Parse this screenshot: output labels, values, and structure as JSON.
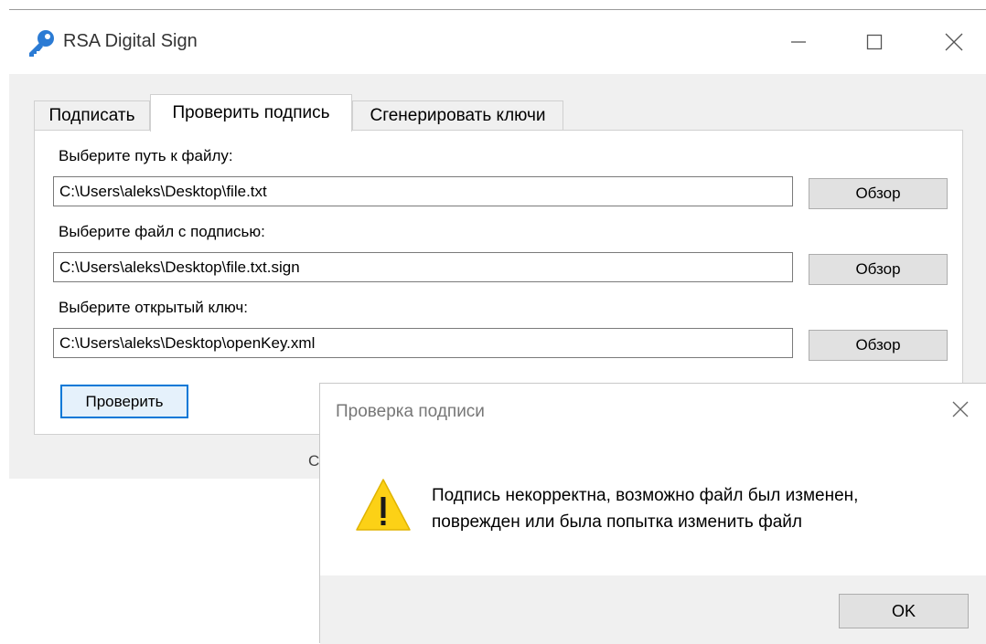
{
  "window": {
    "title": "RSA Digital Sign",
    "icon": "key-icon"
  },
  "tabs": [
    {
      "label": "Подписать",
      "active": false
    },
    {
      "label": "Проверить подпись",
      "active": true
    },
    {
      "label": "Сгенерировать ключи",
      "active": false
    }
  ],
  "form": {
    "file_label": "Выберите путь к файлу:",
    "file_value": "C:\\Users\\aleks\\Desktop\\file.txt",
    "sign_label": "Выберите файл с подписью:",
    "sign_value": "C:\\Users\\aleks\\Desktop\\file.txt.sign",
    "key_label": "Выберите открытый ключ:",
    "key_value": "C:\\Users\\aleks\\Desktop\\openKey.xml",
    "browse_label": "Обзор",
    "verify_label": "Проверить"
  },
  "obscured_text": "С",
  "dialog": {
    "title": "Проверка подписи",
    "message_line1": "Подпись некорректна, возможно файл был изменен,",
    "message_line2": "поврежден или была попытка изменить файл",
    "icon": "warning-icon",
    "ok_label": "OK"
  },
  "colors": {
    "accent": "#0078d7",
    "warning": "#fcd116"
  }
}
